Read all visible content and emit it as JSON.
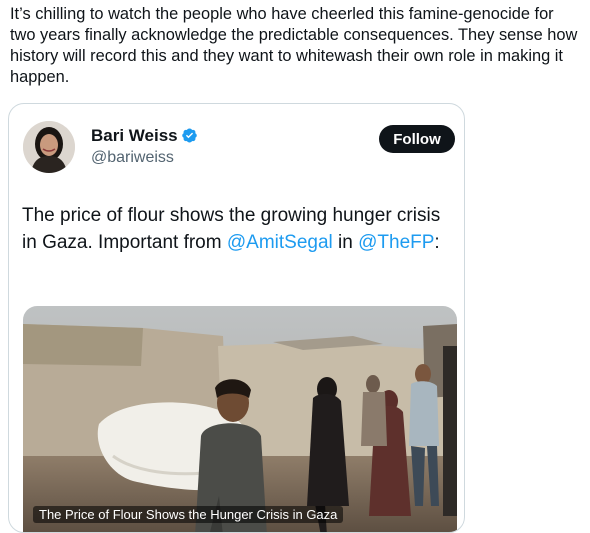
{
  "post": {
    "text": "It’s chilling to watch the people who have cheerled this famine-genocide for two years finally acknowledge the predictable consequences. They sense how history will record this and they want to whitewash their own role in making it happen."
  },
  "quoted": {
    "author_name": "Bari Weiss",
    "handle": "@bariweiss",
    "follow_label": "Follow",
    "body_part1": "The price of flour shows the growing hunger crisis in Gaza. Important from ",
    "mention1": "@AmitSegal",
    "body_part2": " in ",
    "mention2": "@TheFP",
    "body_part3": ":",
    "link_title": "The Price of Flour Shows the Hunger Crisis in Gaza"
  },
  "colors": {
    "link": "#1d9bf0",
    "verified": "#1d9bf0",
    "text": "#0f1419",
    "secondary": "#536471"
  },
  "icons": {
    "verified": "verified-badge-icon",
    "avatar": "profile-photo"
  }
}
